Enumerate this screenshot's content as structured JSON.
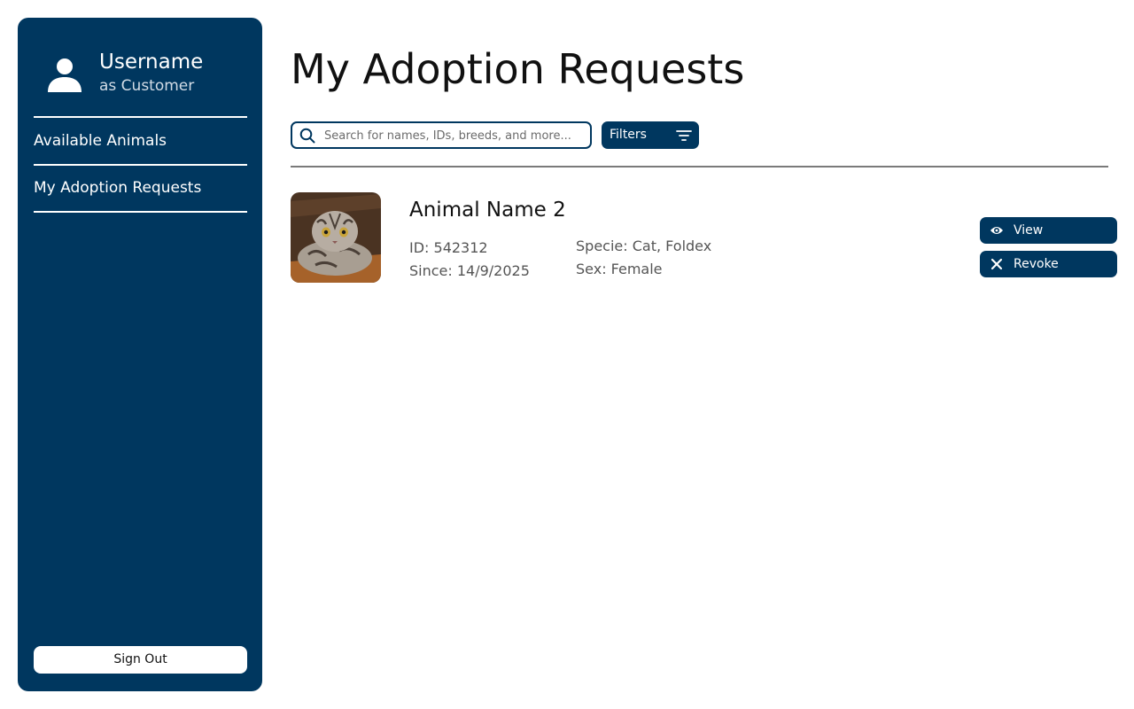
{
  "sidebar": {
    "username": "Username",
    "role": "as Customer",
    "items": [
      {
        "label": "Available Animals"
      },
      {
        "label": "My Adoption Requests"
      }
    ],
    "signout_label": "Sign Out"
  },
  "main": {
    "title": "My Adoption Requests",
    "search": {
      "placeholder": "Search for names, IDs, breeds, and more..."
    },
    "filters_label": "Filters",
    "requests": [
      {
        "name": "Animal Name 2",
        "id": "ID: 542312",
        "since": "Since: 14/9/2025",
        "specie": "Specie: Cat, Foldex",
        "sex": "Sex: Female",
        "actions": {
          "view_label": "View",
          "revoke_label": "Revoke"
        }
      }
    ]
  },
  "icons": {
    "avatar": "user-icon",
    "search": "search-icon",
    "filter": "filter-icon",
    "view": "eye-icon",
    "revoke": "close-icon"
  },
  "colors": {
    "primary": "#00375f",
    "background": "#ffffff",
    "text": "#111111",
    "muted_text": "#555555"
  }
}
